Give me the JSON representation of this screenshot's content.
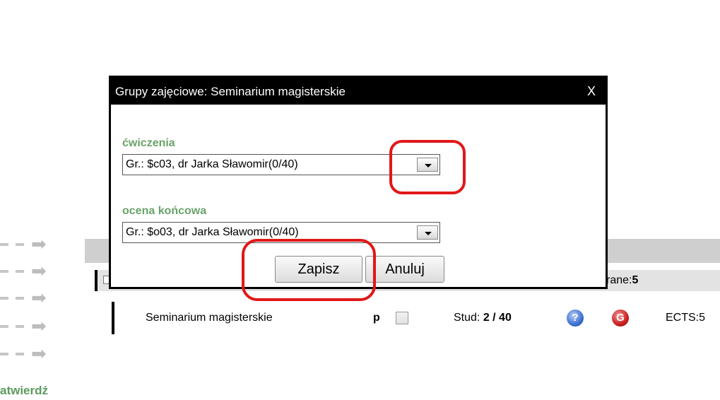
{
  "dialog": {
    "title": "Grupy zajęciowe: Seminarium magisterskie",
    "close_label": "X",
    "fields": [
      {
        "label": "ćwiczenia",
        "selected": "Gr.: $c03, dr Jarka Sławomir(0/40)"
      },
      {
        "label": "ocena końcowa",
        "selected": "Gr.: $o03, dr Jarka Sławomir(0/40)"
      }
    ],
    "save_label": "Zapisz",
    "cancel_label": "Anuluj"
  },
  "background": {
    "wybrane_label": "rane:",
    "wybrane_count": "5",
    "course": {
      "name": "Seminarium magisterskie",
      "type": "p",
      "stud_label": "Stud: ",
      "stud_value": "2 / 40",
      "help_icon": "?",
      "g_icon": "G",
      "ects": "ECTS:5"
    },
    "confirm_label": "atwierdź"
  },
  "colors": {
    "label_green": "#6aa36a",
    "highlight_red": "#e01818",
    "titlebar": "#000000"
  },
  "icons": [
    "chevron-down-icon",
    "help-icon",
    "g-icon",
    "arrow-right-icon",
    "close-icon"
  ]
}
